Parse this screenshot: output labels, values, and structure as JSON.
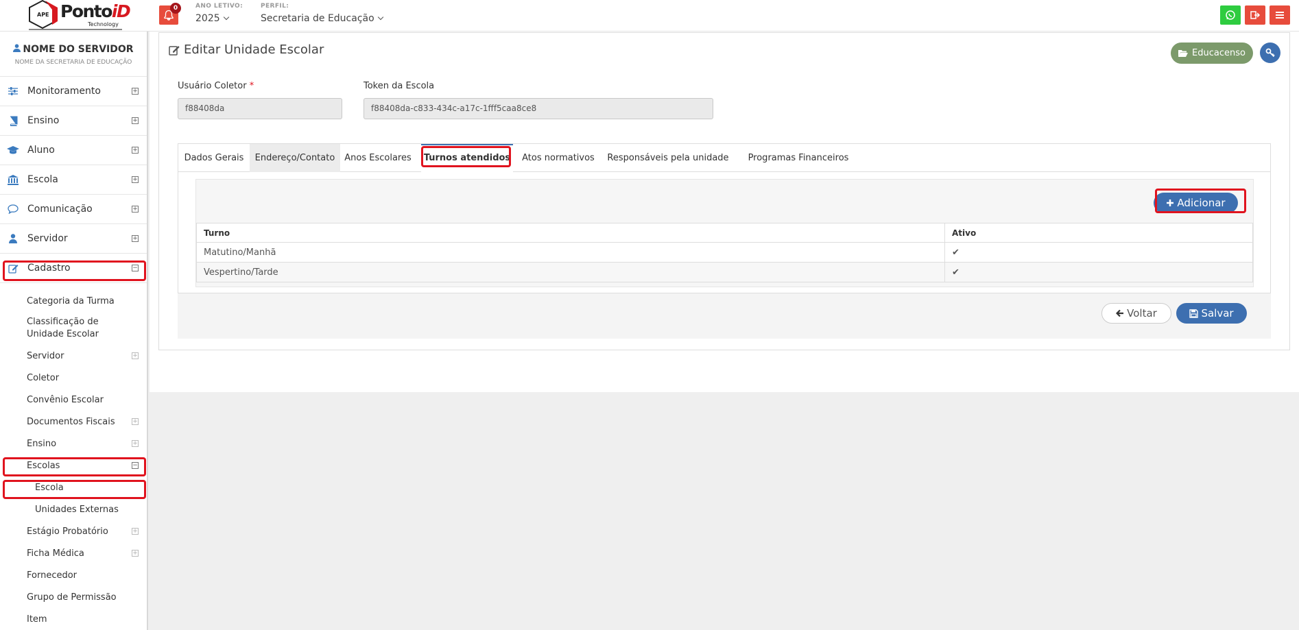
{
  "header": {
    "logo_text_a": "Ponto",
    "logo_text_b": "iD",
    "logo_sub": "Technology",
    "logo_mark": "APE",
    "notification_count": "0",
    "ano_letivo_label": "ANO LETIVO:",
    "ano_letivo_value": "2025",
    "perfil_label": "PERFIL:",
    "perfil_value": "Secretaria de Educação"
  },
  "user": {
    "name": "NOME DO SERVIDOR",
    "org": "NOME DA SECRETARIA DE EDUCAÇÃO"
  },
  "sidebar": {
    "items": [
      {
        "label": "Monitoramento",
        "icon": "sliders-icon"
      },
      {
        "label": "Ensino",
        "icon": "book-icon"
      },
      {
        "label": "Aluno",
        "icon": "graduation-cap-icon"
      },
      {
        "label": "Escola",
        "icon": "institution-icon"
      },
      {
        "label": "Comunicação",
        "icon": "chat-bubble-icon"
      },
      {
        "label": "Servidor",
        "icon": "user-icon"
      },
      {
        "label": "Cadastro",
        "icon": "edit-icon"
      }
    ],
    "sub": {
      "categoria_turma": "Categoria da Turma",
      "classificacao": "Classificação de Unidade Escolar",
      "servidor": "Servidor",
      "coletor": "Coletor",
      "convenio": "Convênio Escolar",
      "documentos": "Documentos Fiscais",
      "ensino": "Ensino",
      "escolas": "Escolas",
      "escola": "Escola",
      "unidades_externas": "Unidades Externas",
      "estagio": "Estágio Probatório",
      "ficha": "Ficha Médica",
      "fornecedor": "Fornecedor",
      "grupo": "Grupo de Permissão",
      "item": "Item"
    }
  },
  "page": {
    "title": "Editar Unidade Escolar",
    "educacenso_label": "Educacenso",
    "usuario_coletor_label": "Usuário Coletor",
    "usuario_coletor_value": "f88408da",
    "token_label": "Token da Escola",
    "token_value": "f88408da-c833-434c-a17c-1fff5caa8ce8",
    "tabs": [
      "Dados Gerais",
      "Endereço/Contato",
      "Anos Escolares",
      "Turnos atendidos",
      "Atos normativos",
      "Responsáveis pela unidade",
      "Programas Financeiros"
    ],
    "add_label": "Adicionar",
    "table": {
      "headers": [
        "Turno",
        "Ativo"
      ],
      "rows": [
        [
          "Matutino/Manhã",
          "✔"
        ],
        [
          "Vespertino/Tarde",
          "✔"
        ]
      ]
    },
    "back_label": "Voltar",
    "save_label": "Salvar"
  },
  "colors": {
    "primary": "#3d6fb0",
    "danger": "#e74c3c",
    "whatsapp": "#2ecc40",
    "educacenso": "#7c9a6b",
    "highlight": "#e0131e"
  }
}
